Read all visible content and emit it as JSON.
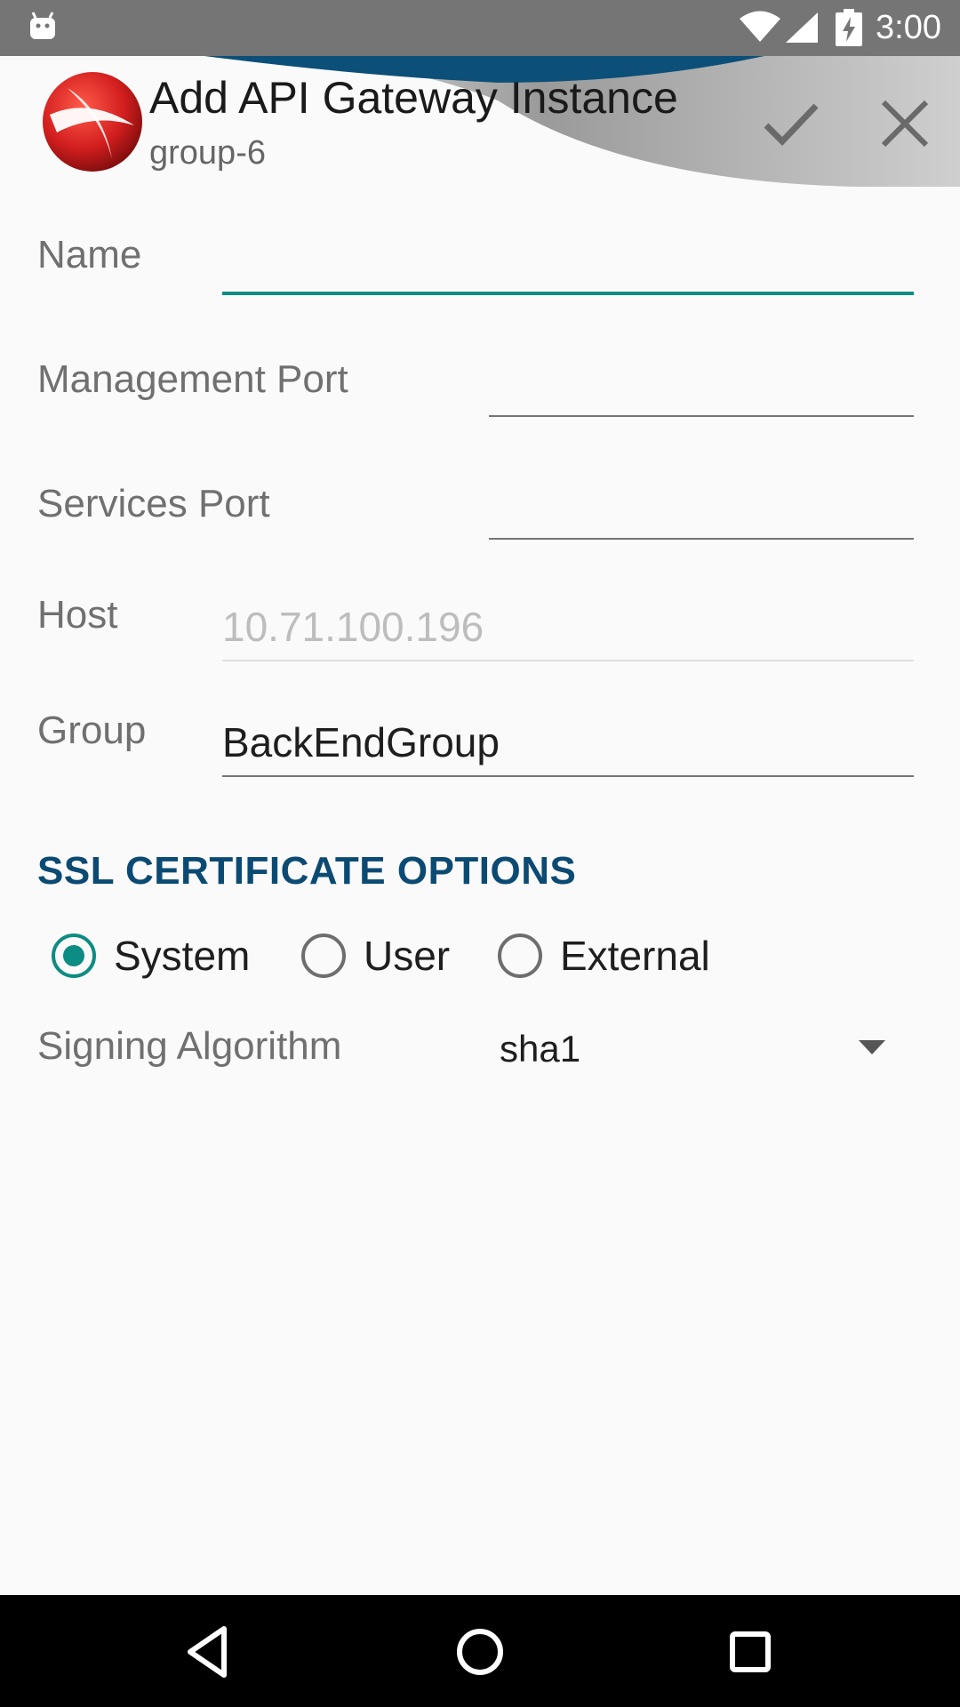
{
  "status_bar": {
    "time": "3:00"
  },
  "header": {
    "title": "Add API Gateway Instance",
    "subtitle": "group-6",
    "icons": {
      "confirm": "check-icon",
      "close": "close-icon",
      "logo": "app-logo-icon"
    }
  },
  "form": {
    "name": {
      "label": "Name",
      "value": ""
    },
    "management_port": {
      "label": "Management Port",
      "value": ""
    },
    "services_port": {
      "label": "Services Port",
      "value": ""
    },
    "host": {
      "label": "Host",
      "value": "10.71.100.196"
    },
    "group": {
      "label": "Group",
      "value": "BackEndGroup"
    }
  },
  "ssl": {
    "header": "SSL CERTIFICATE OPTIONS",
    "options": [
      {
        "label": "System",
        "checked": true
      },
      {
        "label": "User",
        "checked": false
      },
      {
        "label": "External",
        "checked": false
      }
    ]
  },
  "signing": {
    "label": "Signing Algorithm",
    "selected": "sha1"
  },
  "colors": {
    "accent": "#0d8c83",
    "section_header": "#0b4a73",
    "status_bar": "#757575",
    "nav_bar": "#000000"
  }
}
